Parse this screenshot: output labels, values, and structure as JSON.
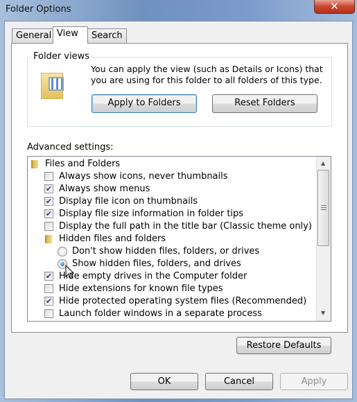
{
  "window": {
    "title": "Folder Options",
    "close_glyph": "✕"
  },
  "tabs": [
    {
      "label": "General"
    },
    {
      "label": "View"
    },
    {
      "label": "Search"
    }
  ],
  "folder_views": {
    "label": "Folder views",
    "description": "You can apply the view (such as Details or Icons) that you are using for this folder to all folders of this type.",
    "apply_label": "Apply to Folders",
    "reset_label": "Reset Folders"
  },
  "advanced": {
    "label": "Advanced settings:",
    "items": [
      {
        "type": "folder",
        "label": "Files and Folders",
        "indent": 0
      },
      {
        "type": "checkbox",
        "label": "Always show icons, never thumbnails",
        "checked": false
      },
      {
        "type": "checkbox",
        "label": "Always show menus",
        "checked": true
      },
      {
        "type": "checkbox",
        "label": "Display file icon on thumbnails",
        "checked": true
      },
      {
        "type": "checkbox",
        "label": "Display file size information in folder tips",
        "checked": true
      },
      {
        "type": "checkbox",
        "label": "Display the full path in the title bar (Classic theme only)",
        "checked": false
      },
      {
        "type": "folder",
        "label": "Hidden files and folders",
        "indent": 1
      },
      {
        "type": "radio",
        "label": "Don't show hidden files, folders, or drives",
        "checked": false
      },
      {
        "type": "radio",
        "label": "Show hidden files, folders, and drives",
        "checked": true
      },
      {
        "type": "checkbox",
        "label": "Hide empty drives in the Computer folder",
        "checked": true
      },
      {
        "type": "checkbox",
        "label": "Hide extensions for known file types",
        "checked": false
      },
      {
        "type": "checkbox",
        "label": "Hide protected operating system files (Recommended)",
        "checked": true
      },
      {
        "type": "checkbox",
        "label": "Launch folder windows in a separate process",
        "checked": false
      },
      {
        "type": "checkbox",
        "label": "",
        "checked": false
      }
    ]
  },
  "restore_label": "Restore Defaults",
  "buttons": {
    "ok": "OK",
    "cancel": "Cancel",
    "apply": "Apply"
  }
}
